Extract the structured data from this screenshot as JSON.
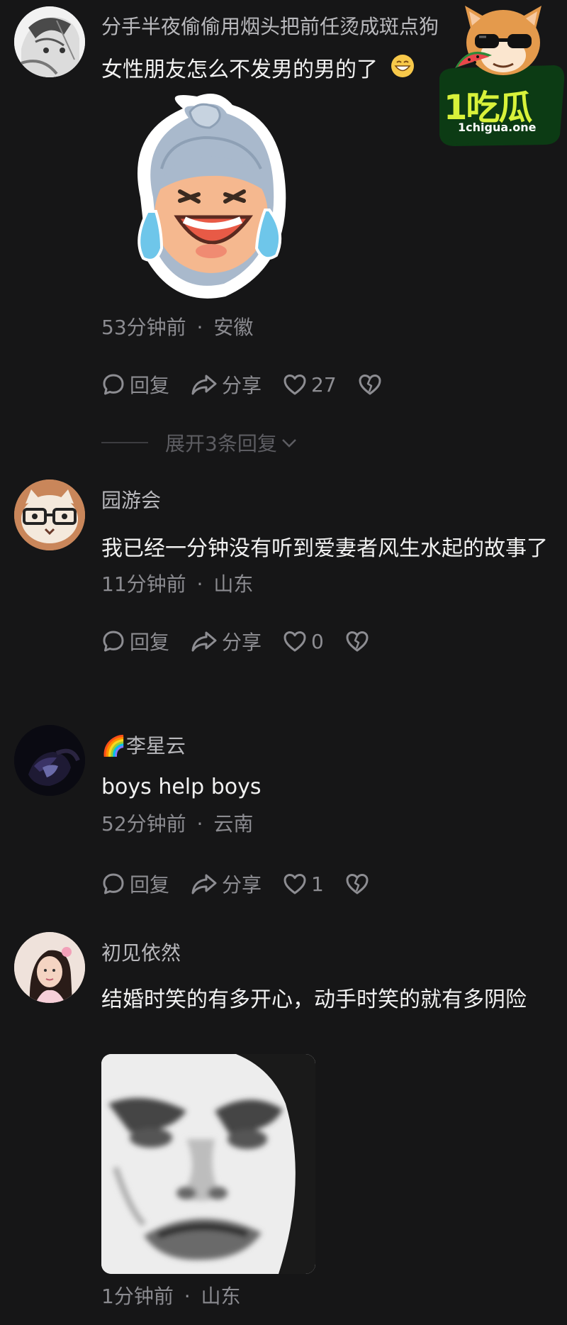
{
  "comments": [
    {
      "name": "分手半夜偷偷用烟头把前任烫成斑点狗",
      "text": "女性朋友怎么不发男的男的了",
      "emoji_icon": "grin-emoji",
      "sticker": "laughing-crying-sticker",
      "time": "53分钟前",
      "location": "安徽",
      "reply_label": "回复",
      "share_label": "分享",
      "likes": "27",
      "expand_label": "展开3条回复"
    },
    {
      "name": "园游会",
      "text": "我已经一分钟没有听到爱妻者风生水起的故事了",
      "time": "11分钟前",
      "location": "山东",
      "reply_label": "回复",
      "share_label": "分享",
      "likes": "0"
    },
    {
      "name": "李星云",
      "name_badge": "🌈",
      "text": "boys help boys",
      "time": "52分钟前",
      "location": "云南",
      "reply_label": "回复",
      "share_label": "分享",
      "likes": "1"
    },
    {
      "name": "初见依然",
      "text": "结婚时笑的有多开心，动手时笑的就有多阴险",
      "sticker": "angry-face-meme",
      "time": "1分钟前",
      "location": "山东"
    }
  ],
  "meta_separator": "·",
  "watermark": {
    "brand": "1吃瓜",
    "site": "1chigua.one"
  },
  "colors": {
    "background": "#161617",
    "primary_text": "#f1f1f1",
    "secondary_text": "#8b8b90",
    "brand_green": "#d8f23a"
  }
}
